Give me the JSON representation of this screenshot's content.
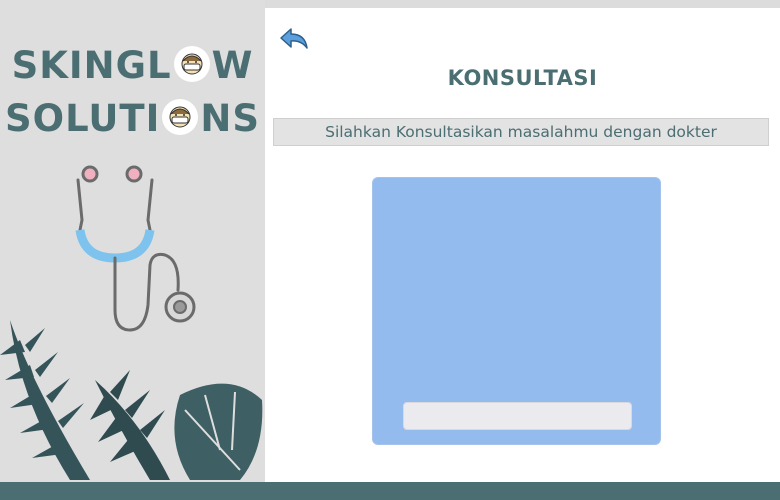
{
  "brand": {
    "line1": "SKINGL",
    "line1_end": "W",
    "line2": "SOLUTI",
    "line2_end": "NS"
  },
  "main": {
    "title": "KONSULTASI",
    "subtitle": "Silahkan Konsultasikan masalahmu dengan dokter",
    "chat_input": {
      "placeholder": "",
      "value": ""
    }
  },
  "colors": {
    "brand_teal": "#4b6e73",
    "chat_panel": "#94bbee",
    "sidebar_bg": "#dedede",
    "footer": "#4b6e73",
    "back_arrow": "#5ba0dc"
  },
  "icons": [
    "back-arrow-icon",
    "face-mask-icon",
    "stethoscope-icon"
  ]
}
